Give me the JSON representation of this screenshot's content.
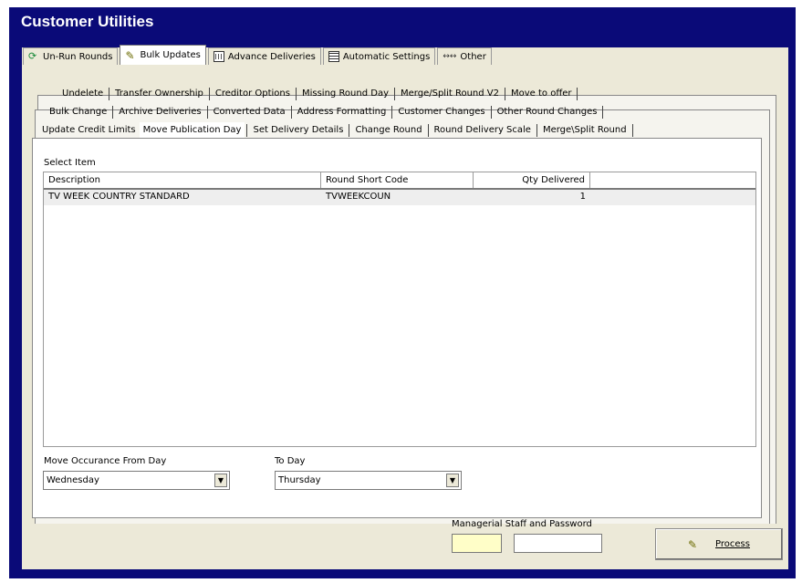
{
  "window": {
    "title": "Customer Utilities"
  },
  "main_tabs": [
    {
      "label": "Un-Run Rounds",
      "icon": "refresh-icon"
    },
    {
      "label": "Bulk Updates",
      "icon": "wand-icon",
      "active": true
    },
    {
      "label": "Advance Deliveries",
      "icon": "calendar-icon"
    },
    {
      "label": "Automatic Settings",
      "icon": "grid-icon"
    },
    {
      "label": "Other",
      "icon": "arrows-icon"
    }
  ],
  "sub_tabs": {
    "row1": [
      "Undelete",
      "Transfer Ownership",
      "Creditor Options",
      "Missing Round Day",
      "Merge/Split Round V2",
      "Move to offer"
    ],
    "row2": [
      "Bulk Change",
      "Archive Deliveries",
      "Converted Data",
      "Address Formatting",
      "Customer Changes",
      "Other Round Changes"
    ],
    "row3": [
      "Update Credit Limits",
      "Move Publication Day",
      "Set Delivery Details",
      "Change Round",
      "Round Delivery Scale",
      "Merge\\Split Round"
    ],
    "active": "Move Publication Day"
  },
  "select_item": {
    "label": "Select Item",
    "columns": [
      "Description",
      "Round Short Code",
      "Qty Delivered"
    ],
    "rows": [
      {
        "description": "TV WEEK COUNTRY STANDARD",
        "round_short_code": "TVWEEKCOUN",
        "qty_delivered": "1"
      }
    ]
  },
  "from_day": {
    "label": "Move Occurance From Day",
    "value": "Wednesday"
  },
  "to_day": {
    "label": "To Day",
    "value": "Thursday"
  },
  "password": {
    "label": "Managerial Staff and Password"
  },
  "process_button": {
    "label": "Process"
  },
  "colors": {
    "frame": "#0a0a78",
    "panel": "#ece9d8",
    "password_highlight": "#fffec8"
  }
}
